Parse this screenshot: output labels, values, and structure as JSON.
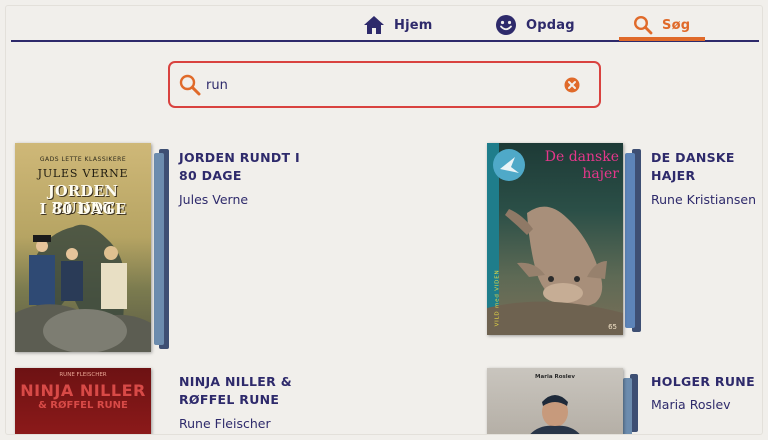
{
  "nav": {
    "items": [
      {
        "label": "Hjem",
        "icon": "home-icon"
      },
      {
        "label": "Opdag",
        "icon": "smiley-icon"
      },
      {
        "label": "Søg",
        "icon": "search-icon",
        "active": true
      }
    ]
  },
  "search": {
    "value": "run",
    "placeholder": ""
  },
  "results": [
    {
      "title_line1": "JORDEN RUNDT I",
      "title_line2": "80 DAGE",
      "author": "Jules Verne",
      "cover": {
        "series": "GADS LETTE KLASSIKERE",
        "author": "JULES VERNE",
        "title_line1": "JORDEN RUNDT",
        "title_line2": "I 80 DAGE"
      }
    },
    {
      "title_line1": "DE DANSKE",
      "title_line2": "HAJER",
      "author": "Rune Kristiansen",
      "cover": {
        "title_line1": "De danske",
        "title_line2": "hajer",
        "spine": "VILD med VIDEN",
        "number": "65"
      }
    },
    {
      "title_line1": "NINJA NILLER &",
      "title_line2": "RØFFEL RUNE",
      "author": "Rune Fleischer",
      "cover": {
        "top": "RUNE FLEISCHER",
        "title_line1": "NINJA NILLER",
        "title_line2": "& RØFFEL RUNE"
      }
    },
    {
      "title_line1": "HOLGER RUNE",
      "title_line2": "",
      "author": "Maria Roslev",
      "cover": {
        "top": "Maria Roslev"
      }
    }
  ],
  "colors": {
    "navy": "#2e2a6b",
    "accent": "#e06a2a",
    "search_border": "#d9423f",
    "background": "#f1efeb"
  }
}
